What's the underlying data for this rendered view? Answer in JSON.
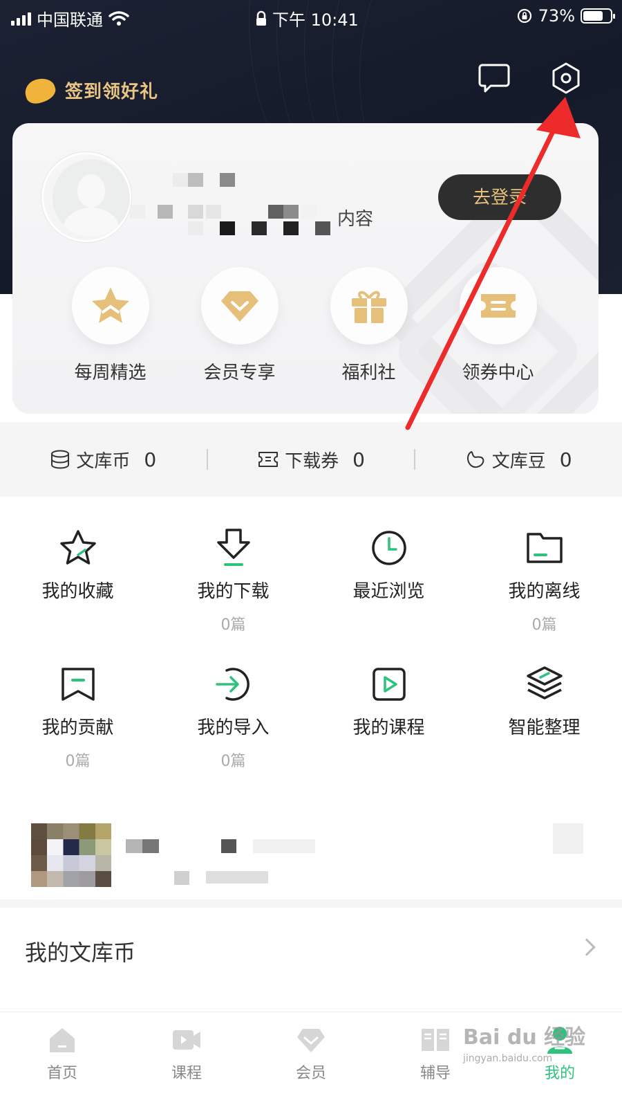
{
  "status_bar": {
    "carrier": "中国联通",
    "time": "下午 10:41",
    "battery_percent": "73%",
    "battery_level": 0.73
  },
  "header": {
    "checkin_label": "签到领好礼",
    "message_icon": "chat-bubble-icon",
    "settings_icon": "settings-hexagon-icon"
  },
  "profile": {
    "login_tip_suffix": "内容",
    "login_button": "去登录"
  },
  "perks": [
    {
      "label": "每周精选",
      "icon": "star-icon"
    },
    {
      "label": "会员专享",
      "icon": "diamond-icon"
    },
    {
      "label": "福利社",
      "icon": "gift-icon"
    },
    {
      "label": "领券中心",
      "icon": "ticket-icon"
    }
  ],
  "counters": [
    {
      "label": "文库币",
      "value": "0",
      "icon": "coin-stack-icon"
    },
    {
      "label": "下载券",
      "value": "0",
      "icon": "voucher-icon"
    },
    {
      "label": "文库豆",
      "value": "0",
      "icon": "bean-icon"
    }
  ],
  "functions": [
    {
      "label": "我的收藏",
      "sub": "",
      "icon": "star-outline-icon"
    },
    {
      "label": "我的下载",
      "sub": "0篇",
      "icon": "download-icon"
    },
    {
      "label": "最近浏览",
      "sub": "",
      "icon": "clock-icon"
    },
    {
      "label": "我的离线",
      "sub": "0篇",
      "icon": "folder-icon"
    },
    {
      "label": "我的贡献",
      "sub": "0篇",
      "icon": "bookmark-icon"
    },
    {
      "label": "我的导入",
      "sub": "0篇",
      "icon": "import-icon"
    },
    {
      "label": "我的课程",
      "sub": "",
      "icon": "play-icon"
    },
    {
      "label": "智能整理",
      "sub": "",
      "icon": "layers-icon"
    }
  ],
  "wallet_row": {
    "label": "我的文库币"
  },
  "tabs": [
    {
      "label": "首页",
      "icon": "home-icon"
    },
    {
      "label": "课程",
      "icon": "video-icon"
    },
    {
      "label": "会员",
      "icon": "diamond-tab-icon"
    },
    {
      "label": "辅导",
      "icon": "book-icon"
    },
    {
      "label": "我的",
      "icon": "user-icon",
      "active": true
    }
  ],
  "watermark": {
    "text": "Bai du 经验",
    "url": "jingyan.baidu.com"
  },
  "colors": {
    "accent": "#2ec27e",
    "gold": "#e5c17c",
    "header_bg": "#181e2d",
    "arrow": "#ee2b2b"
  }
}
